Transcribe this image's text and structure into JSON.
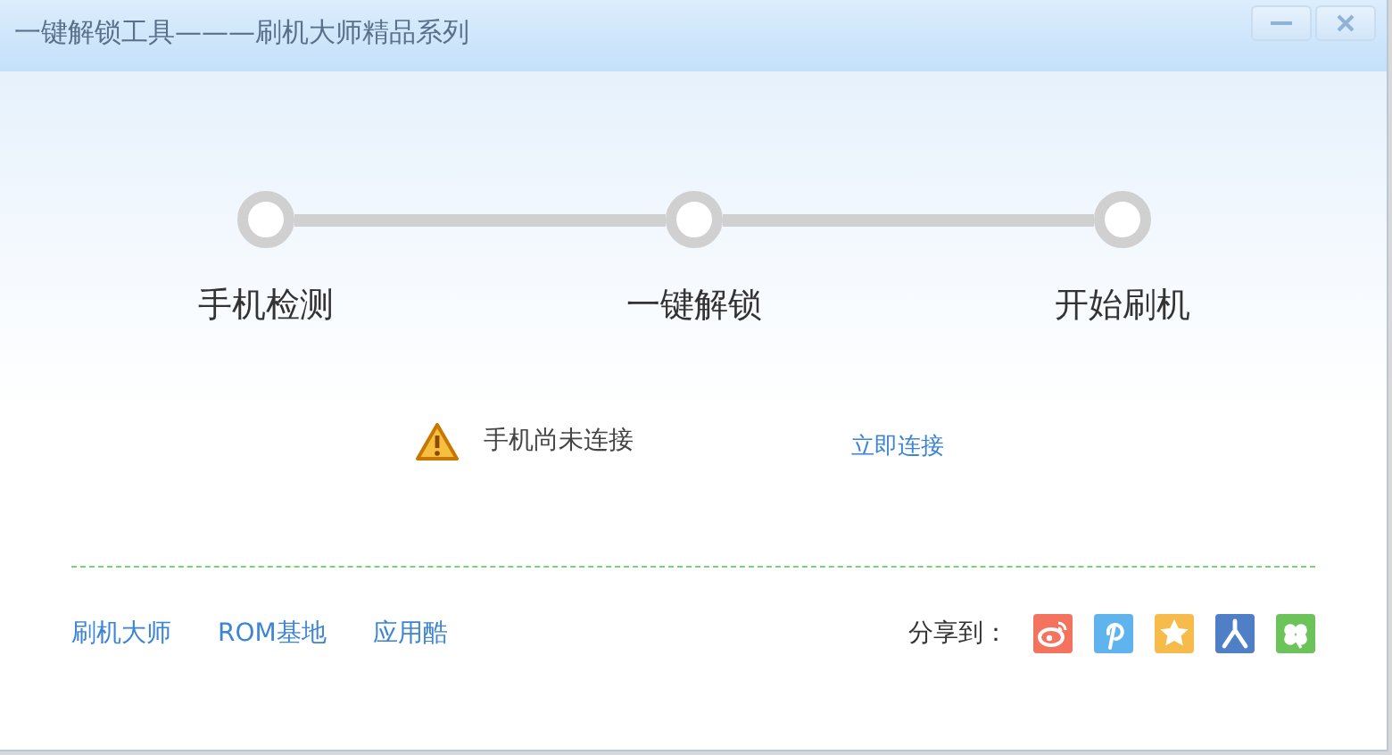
{
  "window": {
    "title": "一键解锁工具———刷机大师精品系列"
  },
  "steps": [
    {
      "label": "手机检测"
    },
    {
      "label": "一键解锁"
    },
    {
      "label": "开始刷机"
    }
  ],
  "status": {
    "message": "手机尚未连接",
    "action": "立即连接"
  },
  "footer_links": [
    "刷机大师",
    "ROM基地",
    "应用酷"
  ],
  "share": {
    "label": "分享到：",
    "targets": [
      {
        "kind": "weibo",
        "color": "#f4735f"
      },
      {
        "kind": "pin",
        "color": "#5fb4ee"
      },
      {
        "kind": "star",
        "color": "#f6bb4a"
      },
      {
        "kind": "person",
        "color": "#4f7fc6"
      },
      {
        "kind": "clover",
        "color": "#6bc35a"
      }
    ]
  }
}
